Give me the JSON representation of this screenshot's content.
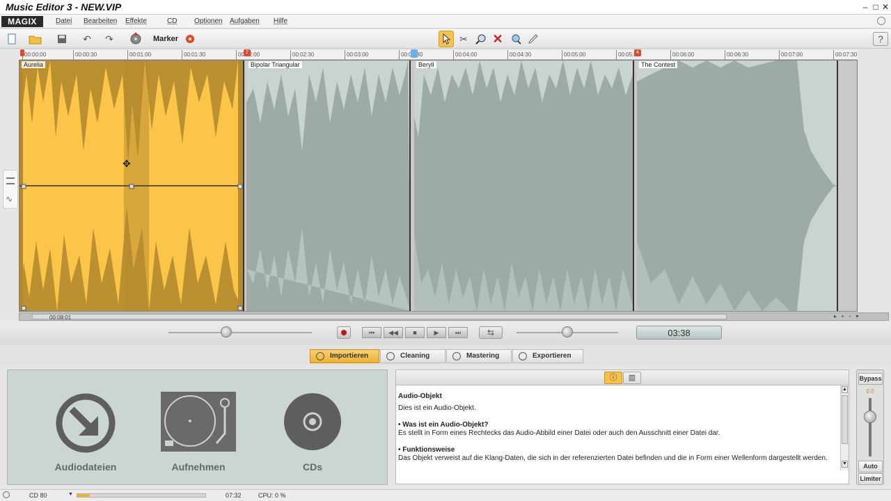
{
  "window": {
    "title": "Music Editor 3 - NEW.VIP"
  },
  "menu": {
    "brand": "MAGIX",
    "items": [
      "Datei",
      "Bearbeiten",
      "Effekte",
      "CD",
      "Optionen",
      "Aufgaben",
      "Hilfe"
    ]
  },
  "toolbar": {
    "marker_label": "Marker"
  },
  "ruler": {
    "ticks": [
      "00:00:00",
      "00:00:30",
      "00:01:00",
      "00:01:30",
      "00:02:00",
      "00:02:30",
      "00:03:00",
      "00:03:30",
      "00:04:00",
      "00:04:30",
      "00:05:00",
      "00:05:30",
      "00:06:00",
      "00:06:30",
      "00:07:00",
      "00:07:30"
    ],
    "markers": [
      "2",
      "4"
    ]
  },
  "tracks": [
    {
      "name": "Aurelia",
      "selected": true
    },
    {
      "name": "Bipolar Triangular",
      "selected": false
    },
    {
      "name": "Beryll",
      "selected": false
    },
    {
      "name": "The Contest",
      "selected": false
    }
  ],
  "scroll": {
    "timecode": "00:08:01"
  },
  "transport": {
    "time_display": "03:38"
  },
  "tabs": [
    "Importieren",
    "Cleaning",
    "Mastering",
    "Exportieren"
  ],
  "import": {
    "audio_files": "Audiodateien",
    "record": "Aufnehmen",
    "cds": "CDs"
  },
  "info": {
    "heading": "Audio-Objekt",
    "intro": "Dies ist ein Audio-Objekt.",
    "q1_title": "• Was ist ein Audio-Objekt?",
    "q1_text": "Es stellt in Form eines Rechtecks das Audio-Abbild einer Datei oder auch den Ausschnitt einer Datei dar.",
    "q2_title": "• Funktionsweise",
    "q2_text": "Das Objekt verweist auf die Klang-Daten, die sich in der referenzierten Datei befinden und die in Form einer Wellenform dargestellt werden."
  },
  "bypass": {
    "bypass": "Bypass",
    "value": "0.0",
    "auto": "Auto",
    "limiter": "Limiter"
  },
  "status": {
    "cd": "CD 80",
    "time": "07:32",
    "cpu": "CPU: 0 %",
    "cd_progress": 0.1
  },
  "colors": {
    "accent": "#f6c24a",
    "selected_object": "#fbc54a",
    "object": "#c8d3d2",
    "record": "#c4141b"
  }
}
